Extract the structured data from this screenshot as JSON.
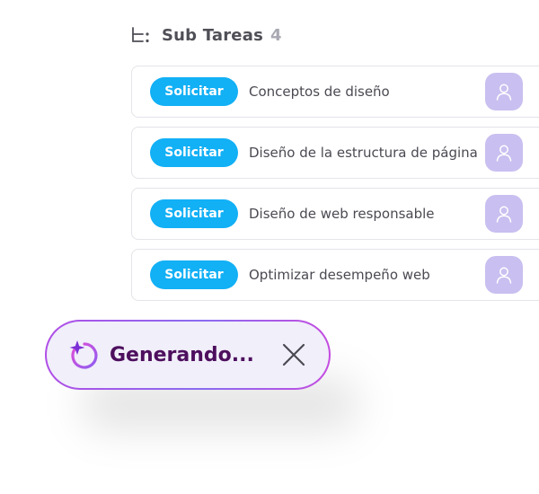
{
  "header": {
    "title": "Sub Tareas",
    "count": "4",
    "icon": "subtasks-icon"
  },
  "tasks": [
    {
      "button_label": "Solicitar",
      "name": "Conceptos de diseño"
    },
    {
      "button_label": "Solicitar",
      "name": "Diseño de la estructura de página"
    },
    {
      "button_label": "Solicitar",
      "name": "Diseño de web responsable"
    },
    {
      "button_label": "Solicitar",
      "name": "Optimizar desempeño web"
    }
  ],
  "generating": {
    "label": "Generando...",
    "icon": "sparkle-refresh-icon",
    "close_icon": "close-icon"
  },
  "colors": {
    "button": "#12b0f5",
    "avatar": "#c9bff0",
    "generating_text": "#4d0f5e",
    "pill_border_start": "#b04ee6",
    "pill_border_end": "#8a6cf0"
  }
}
